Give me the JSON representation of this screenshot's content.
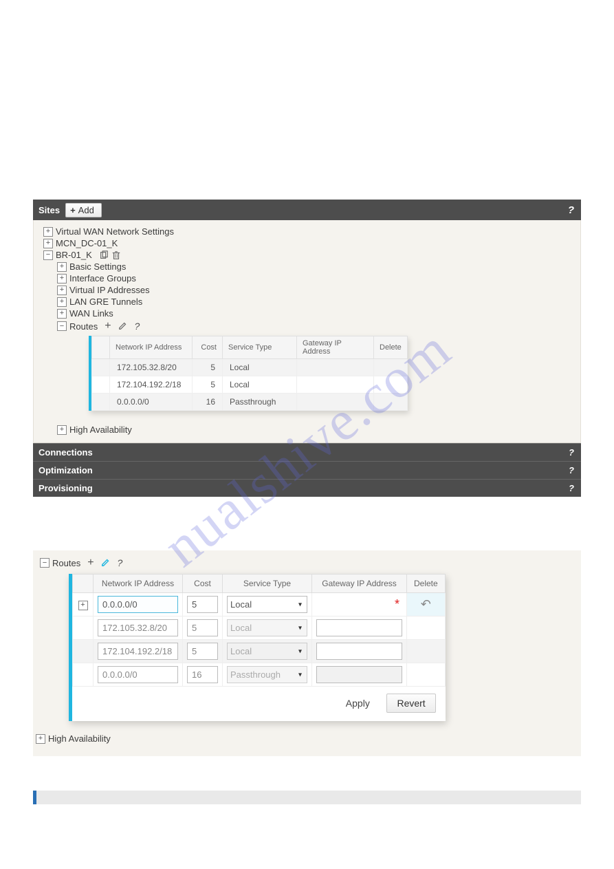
{
  "watermark": "nualshive.com",
  "sites_bar": {
    "label": "Sites",
    "add_label": "Add"
  },
  "tree": {
    "vwan": "Virtual WAN Network Settings",
    "mcn": "MCN_DC-01_K",
    "br": "BR-01_K",
    "basic": "Basic Settings",
    "ifg": "Interface Groups",
    "vip": "Virtual IP Addresses",
    "gre": "LAN GRE Tunnels",
    "wan": "WAN Links",
    "routes": "Routes",
    "ha": "High Availability"
  },
  "routes_table": {
    "headers": {
      "net": "Network IP Address",
      "cost": "Cost",
      "svc": "Service Type",
      "gw": "Gateway IP Address",
      "del": "Delete"
    },
    "rows": [
      {
        "net": "172.105.32.8/20",
        "cost": "5",
        "svc": "Local",
        "gw": ""
      },
      {
        "net": "172.104.192.2/18",
        "cost": "5",
        "svc": "Local",
        "gw": ""
      },
      {
        "net": "0.0.0.0/0",
        "cost": "16",
        "svc": "Passthrough",
        "gw": ""
      }
    ]
  },
  "bars": {
    "connections": "Connections",
    "optimization": "Optimization",
    "provisioning": "Provisioning"
  },
  "routes2": {
    "title": "Routes",
    "headers": {
      "net": "Network IP Address",
      "cost": "Cost",
      "svc": "Service Type",
      "gw": "Gateway IP Address",
      "del": "Delete"
    },
    "new_row": {
      "net": "0.0.0.0/0",
      "cost": "5",
      "svc": "Local",
      "gw": ""
    },
    "rows": [
      {
        "net": "172.105.32.8/20",
        "cost": "5",
        "svc": "Local",
        "gw": ""
      },
      {
        "net": "172.104.192.2/18",
        "cost": "5",
        "svc": "Local",
        "gw": ""
      },
      {
        "net": "0.0.0.0/0",
        "cost": "16",
        "svc": "Passthrough",
        "gw": ""
      }
    ],
    "apply": "Apply",
    "revert": "Revert"
  },
  "ha2": "High Availability"
}
